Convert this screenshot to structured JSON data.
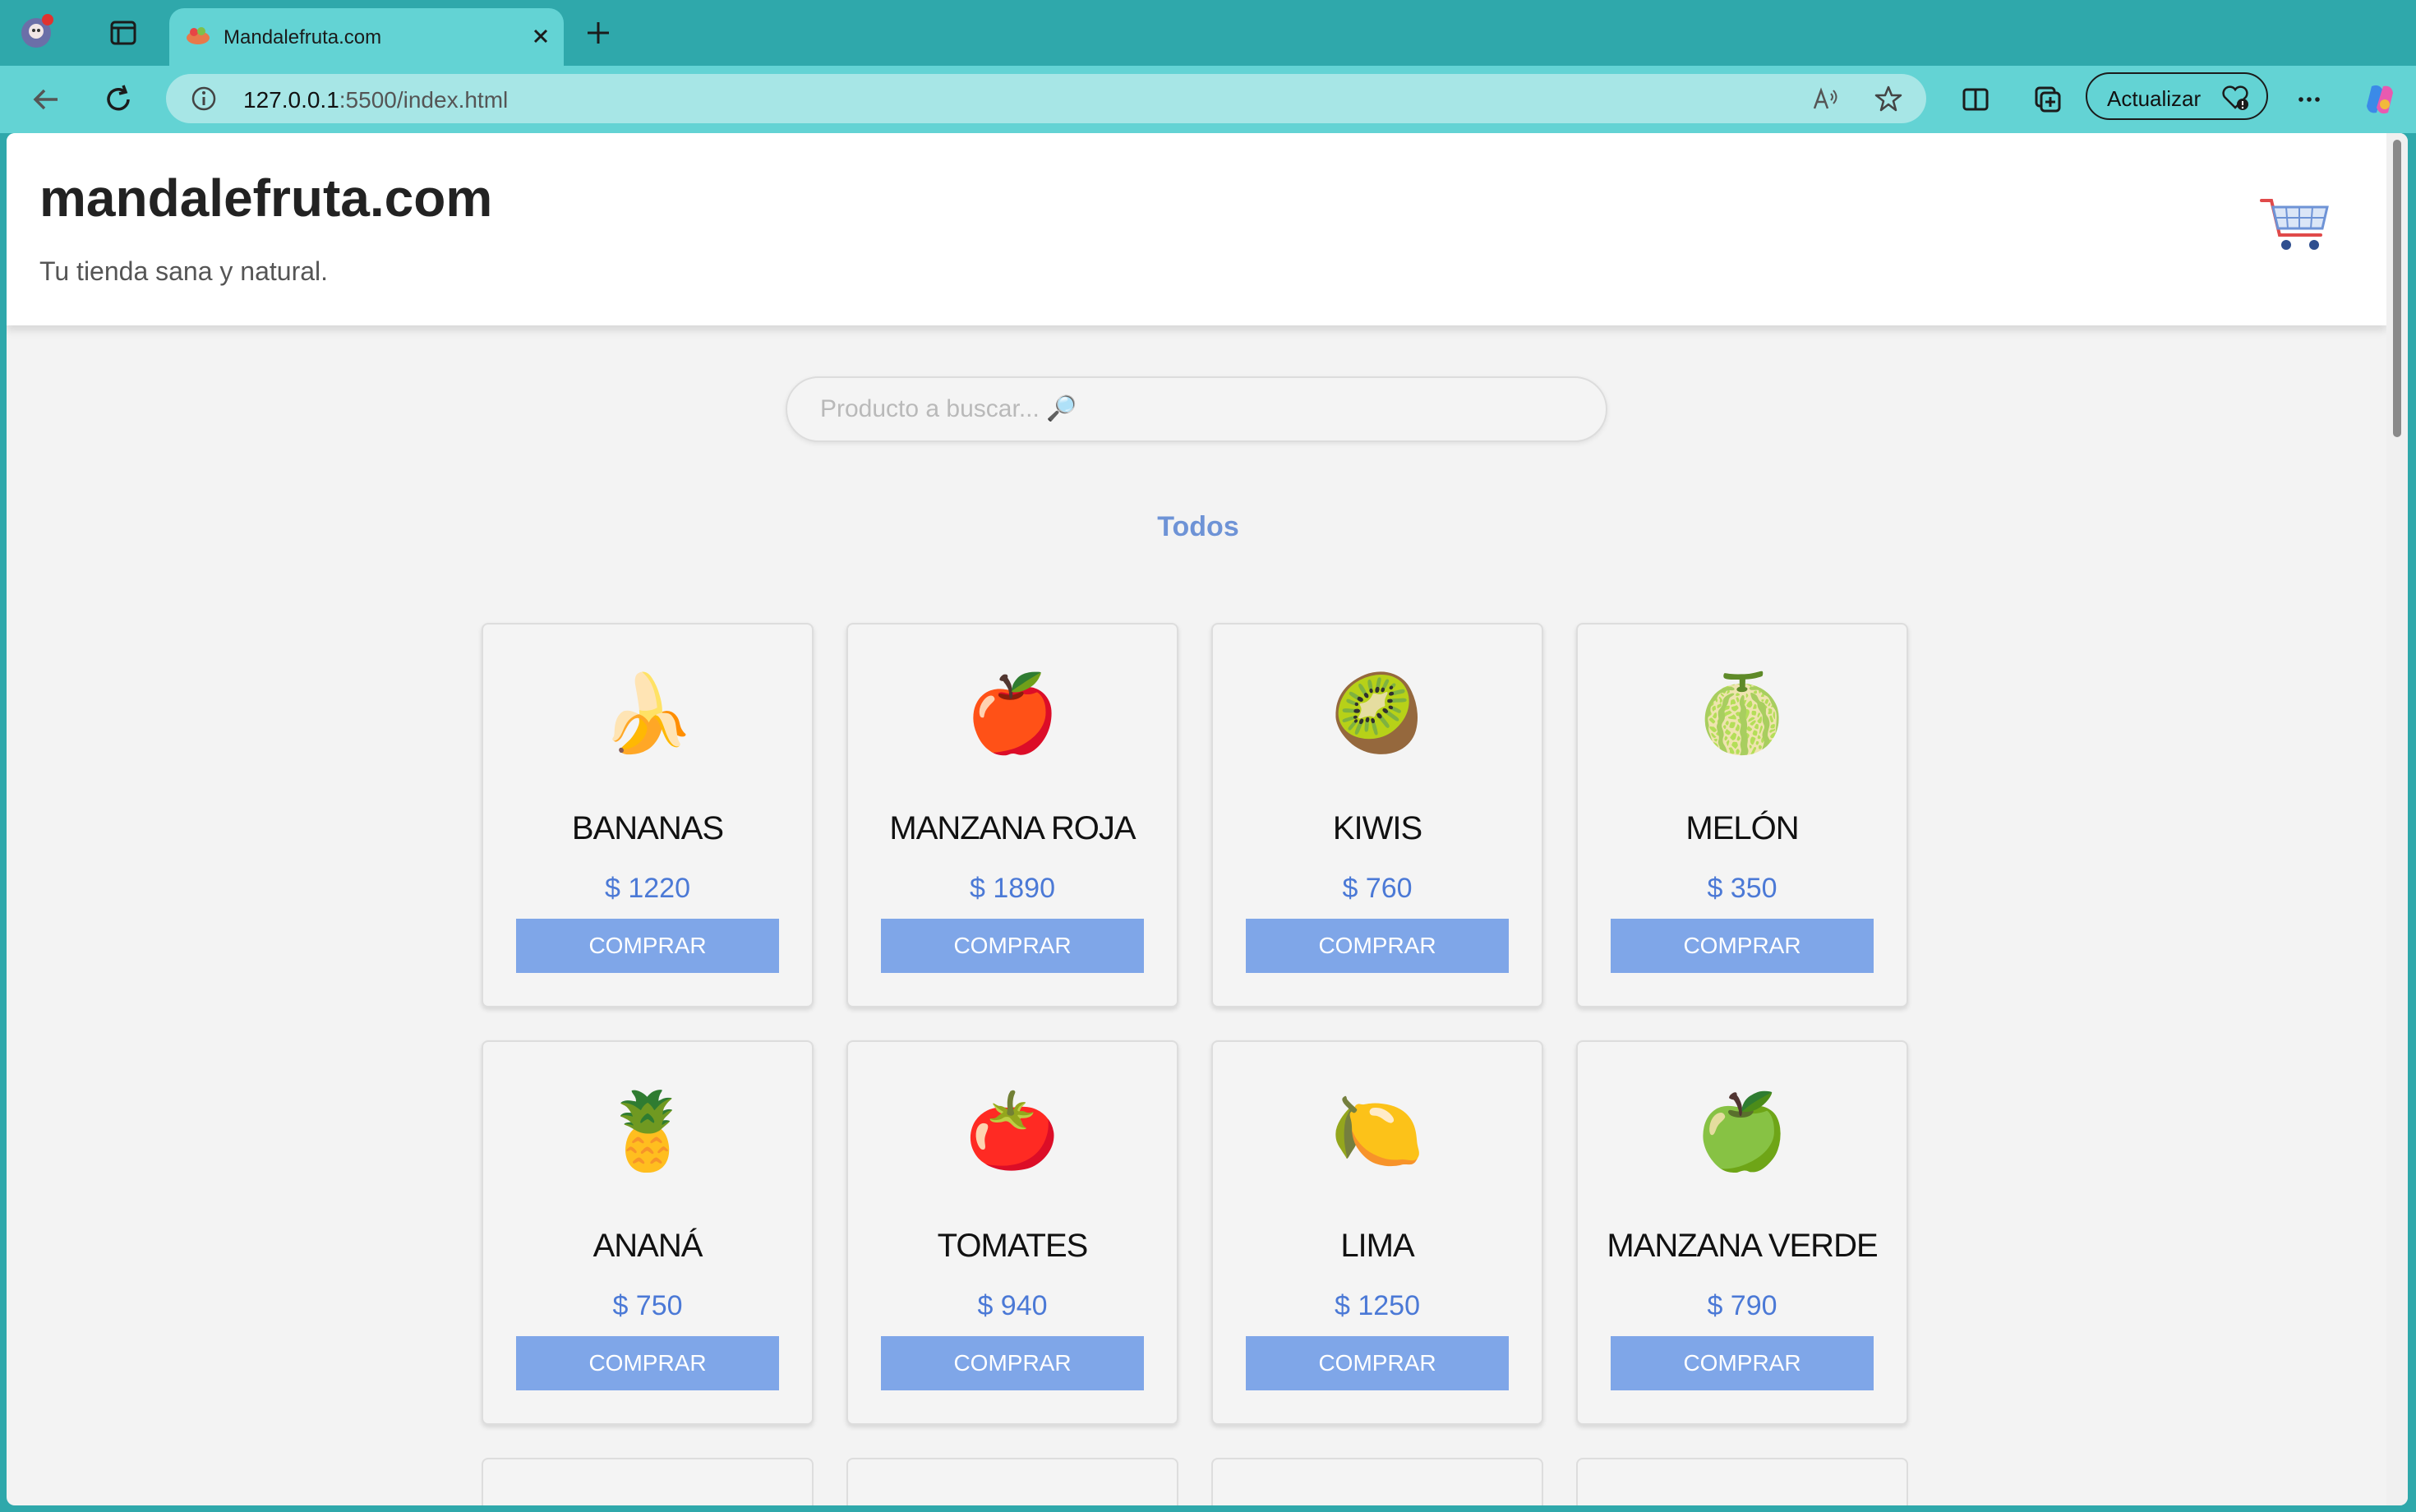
{
  "browser": {
    "tab_title": "Mandalefruta.com",
    "url_host": "127.0.0.1",
    "url_rest": ":5500/index.html",
    "update_label": "Actualizar"
  },
  "site": {
    "title": "mandalefruta.com",
    "subtitle": "Tu tienda sana y natural.",
    "search_placeholder": "Producto a buscar... 🔎",
    "filter_label": "Todos",
    "buy_label": "COMPRAR"
  },
  "products": [
    {
      "emoji": "🍌",
      "name": "BANANAS",
      "price": "$ 1220"
    },
    {
      "emoji": "🍎",
      "name": "MANZANA ROJA",
      "price": "$ 1890"
    },
    {
      "emoji": "🥝",
      "name": "KIWIS",
      "price": "$ 760"
    },
    {
      "emoji": "🍈",
      "name": "MELÓN",
      "price": "$ 350"
    },
    {
      "emoji": "🍍",
      "name": "ANANÁ",
      "price": "$ 750"
    },
    {
      "emoji": "🍅",
      "name": "TOMATES",
      "price": "$ 940"
    },
    {
      "emoji": "🍋",
      "name": "LIMA",
      "price": "$ 1250"
    },
    {
      "emoji": "🍏",
      "name": "MANZANA VERDE",
      "price": "$ 790"
    }
  ],
  "colors": {
    "accent": "#7fa6e8",
    "price": "#4b79d6",
    "browser_frame": "#2fa8ab",
    "toolbar": "#63d3d4"
  }
}
